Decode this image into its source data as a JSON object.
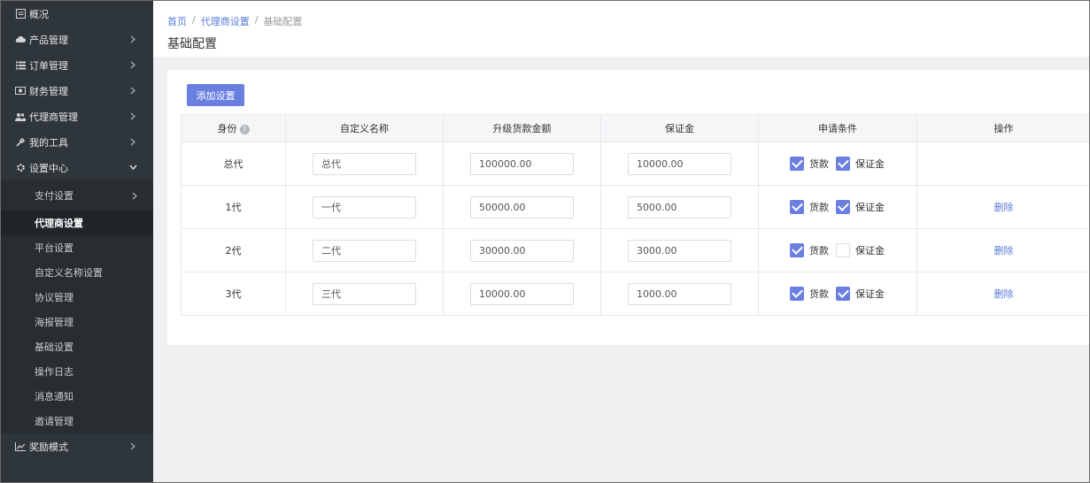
{
  "sidebar": {
    "items": [
      {
        "label": "概况",
        "icon": "overview-icon"
      },
      {
        "label": "产品管理",
        "icon": "cloud-icon"
      },
      {
        "label": "订单管理",
        "icon": "list-icon"
      },
      {
        "label": "财务管理",
        "icon": "money-icon"
      },
      {
        "label": "代理商管理",
        "icon": "users-icon"
      },
      {
        "label": "我的工具",
        "icon": "tools-icon"
      },
      {
        "label": "设置中心",
        "icon": "gear-icon"
      }
    ],
    "sub_items": [
      {
        "label": "支付设置"
      },
      {
        "label": "代理商设置"
      },
      {
        "label": "平台设置"
      },
      {
        "label": "自定义名称设置"
      },
      {
        "label": "协议管理"
      },
      {
        "label": "海报管理"
      },
      {
        "label": "基础设置"
      },
      {
        "label": "操作日志"
      },
      {
        "label": "消息通知"
      },
      {
        "label": "邀请管理"
      }
    ],
    "last_item": {
      "label": "奖励模式",
      "icon": "chart-icon"
    }
  },
  "breadcrumb": {
    "home": "首页",
    "sep": "/",
    "parent": "代理商设置",
    "current": "基础配置"
  },
  "page_title": "基础配置",
  "add_button": "添加设置",
  "table": {
    "headers": [
      "身份",
      "自定义名称",
      "升级货款金额",
      "保证金",
      "申请条件",
      "操作"
    ],
    "help_mark": "?",
    "cond_labels": {
      "payment": "货款",
      "deposit": "保证金"
    },
    "delete_label": "删除",
    "rows": [
      {
        "identity": "总代",
        "custom_name": "总代",
        "upgrade_amount": "100000.00",
        "deposit": "10000.00",
        "cond_payment": true,
        "cond_deposit": true,
        "deletable": false
      },
      {
        "identity": "1代",
        "custom_name": "一代",
        "upgrade_amount": "50000.00",
        "deposit": "5000.00",
        "cond_payment": true,
        "cond_deposit": true,
        "deletable": true
      },
      {
        "identity": "2代",
        "custom_name": "二代",
        "upgrade_amount": "30000.00",
        "deposit": "3000.00",
        "cond_payment": true,
        "cond_deposit": false,
        "deletable": true
      },
      {
        "identity": "3代",
        "custom_name": "三代",
        "upgrade_amount": "10000.00",
        "deposit": "1000.00",
        "cond_payment": true,
        "cond_deposit": true,
        "deletable": true
      }
    ]
  },
  "colors": {
    "sidebar_bg": "#2f363b",
    "accent": "#6b7fe0",
    "link": "#5a7bd8"
  }
}
